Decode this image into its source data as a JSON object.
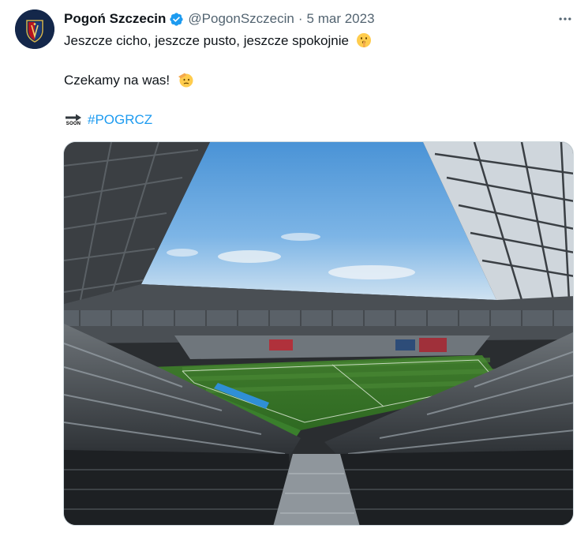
{
  "tweet": {
    "author_name": "Pogoń Szczecin",
    "handle": "@PogonSzczecin",
    "separator": "·",
    "date": "5 mar 2023",
    "line1": "Jeszcze cicho, jeszcze pusto, jeszcze spokojnie",
    "line2": "Czekamy na was!",
    "soon_label": "SOON",
    "hashtag": "#POGRCZ",
    "icons": {
      "verified": "verified-badge-icon",
      "more": "more-options-icon",
      "shush_emoji": "shushing-face-emoji",
      "salute_emoji": "saluting-face-emoji",
      "soon_emoji": "soon-arrow-emoji"
    },
    "colors": {
      "verified": "#1d9bf0",
      "hashtag": "#1d9bf0",
      "secondary_text": "#536471",
      "avatar_bg": "#14274a"
    },
    "media": {
      "subject": "stadium-photo"
    }
  }
}
